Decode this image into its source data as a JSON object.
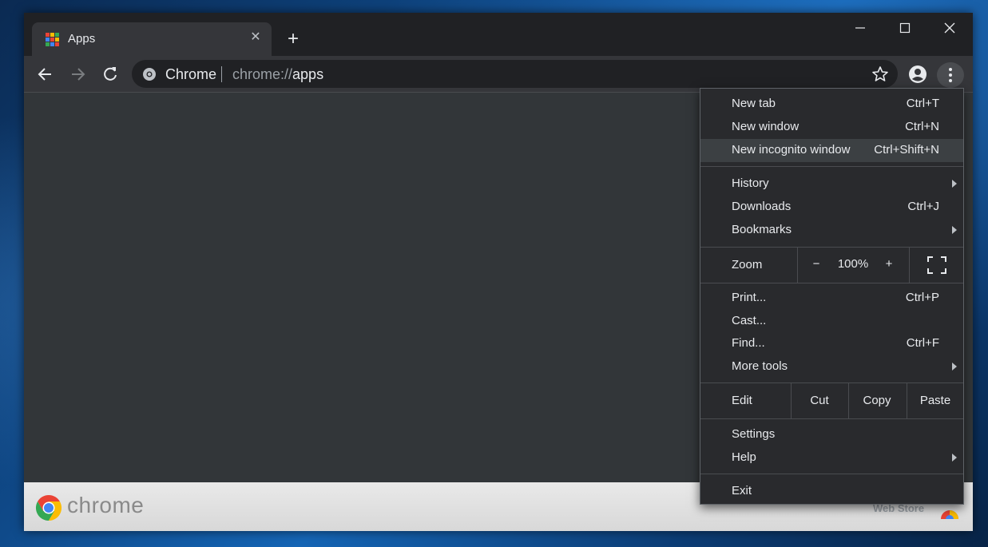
{
  "tab": {
    "title": "Apps",
    "icon": "apps-grid-icon",
    "close": "✕"
  },
  "new_tab_symbol": "+",
  "omnibox": {
    "origin": "Chrome",
    "url_scheme": "chrome://",
    "url_host": "apps"
  },
  "footer": {
    "brand": "chrome",
    "webstore": "Web Store"
  },
  "menu": {
    "group1": [
      {
        "label": "New tab",
        "shortcut": "Ctrl+T"
      },
      {
        "label": "New window",
        "shortcut": "Ctrl+N"
      },
      {
        "label": "New incognito window",
        "shortcut": "Ctrl+Shift+N"
      }
    ],
    "group2": [
      {
        "label": "History",
        "shortcut": ""
      },
      {
        "label": "Downloads",
        "shortcut": "Ctrl+J"
      },
      {
        "label": "Bookmarks",
        "shortcut": ""
      }
    ],
    "zoom": {
      "label": "Zoom",
      "minus": "−",
      "level": "100%",
      "plus": "+"
    },
    "group3": [
      {
        "label": "Print...",
        "shortcut": "Ctrl+P"
      },
      {
        "label": "Cast...",
        "shortcut": ""
      },
      {
        "label": "Find...",
        "shortcut": "Ctrl+F"
      },
      {
        "label": "More tools",
        "shortcut": ""
      }
    ],
    "edit": {
      "label": "Edit",
      "cut": "Cut",
      "copy": "Copy",
      "paste": "Paste"
    },
    "group4": [
      {
        "label": "Settings"
      },
      {
        "label": "Help"
      }
    ],
    "exit": "Exit"
  },
  "colors": {
    "frame": "#202124",
    "toolbar": "#35363a",
    "content": "#323639",
    "menu_bg": "#292a2d",
    "highlight": "#3c4043",
    "text": "#e8eaed"
  }
}
